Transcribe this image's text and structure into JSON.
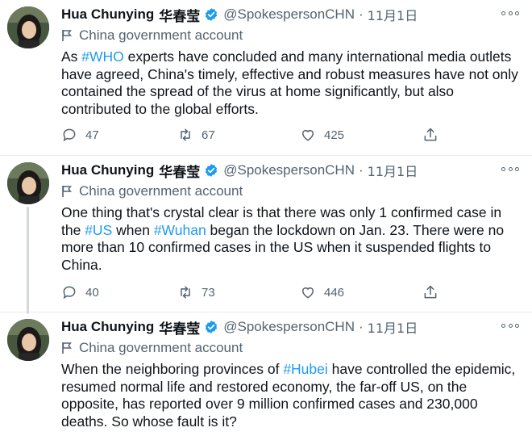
{
  "colors": {
    "accent": "#1d9bf0",
    "muted": "#536471",
    "text": "#0f1419",
    "divider": "#e6ecf0"
  },
  "tweets": [
    {
      "name": "Hua Chunying",
      "cjk_name": "华春莹",
      "handle": "@SpokespersonCHN",
      "dot": "·",
      "date": "11月1日",
      "label": "China government account",
      "text": {
        "p1": "As ",
        "tag1": "#WHO",
        "p2": " experts have concluded and many international media outlets have agreed, China's timely, effective and robust measures have not only contained the spread of the virus at home significantly, but also contributed to the global efforts."
      },
      "replies": "47",
      "retweets": "67",
      "likes": "425"
    },
    {
      "name": "Hua Chunying",
      "cjk_name": "华春莹",
      "handle": "@SpokespersonCHN",
      "dot": "·",
      "date": "11月1日",
      "label": "China government account",
      "text": {
        "p1": "One thing that's crystal clear is that there was only 1 confirmed case in the ",
        "tag1": "#US",
        "p2": " when ",
        "tag2": "#Wuhan",
        "p3": " began the lockdown on Jan. 23. There were no more than 10 confirmed cases in the US when it suspended flights to China."
      },
      "replies": "40",
      "retweets": "73",
      "likes": "446"
    },
    {
      "name": "Hua Chunying",
      "cjk_name": "华春莹",
      "handle": "@SpokespersonCHN",
      "dot": "·",
      "date": "11月1日",
      "label": "China government account",
      "text": {
        "p1": "When the neighboring provinces of ",
        "tag1": "#Hubei",
        "p2": " have controlled the epidemic, resumed normal life and restored economy, the far-off US, on the opposite, has reported over 9 million confirmed cases and 230,000 deaths. So whose fault is it?"
      }
    }
  ],
  "icons": {
    "avatar": "avatar",
    "verified": "verified-badge-icon",
    "flag": "flag-icon",
    "more": "more-options-icon",
    "reply": "reply-icon",
    "retweet": "retweet-icon",
    "like": "heart-icon",
    "share": "share-icon"
  }
}
